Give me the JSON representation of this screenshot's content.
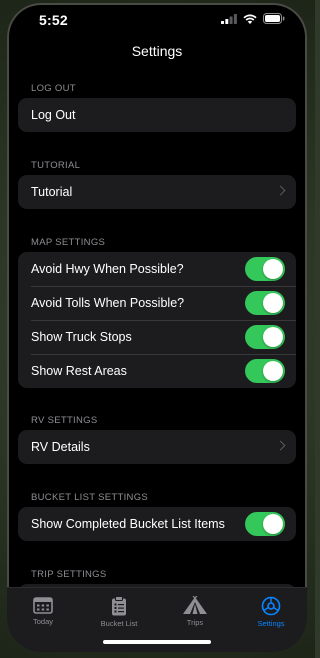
{
  "status_bar": {
    "time": "5:52"
  },
  "nav": {
    "title": "Settings"
  },
  "sections": {
    "log_out": {
      "header": "LOG OUT",
      "item": "Log Out"
    },
    "tutorial": {
      "header": "TUTORIAL",
      "item": "Tutorial"
    },
    "map_settings": {
      "header": "MAP SETTINGS",
      "items": [
        {
          "label": "Avoid Hwy When Possible?",
          "on": true
        },
        {
          "label": "Avoid Tolls When Possible?",
          "on": true
        },
        {
          "label": "Show Truck Stops",
          "on": true
        },
        {
          "label": "Show Rest Areas",
          "on": true
        }
      ]
    },
    "rv_settings": {
      "header": "RV SETTINGS",
      "item": "RV Details"
    },
    "bucket_list_settings": {
      "header": "BUCKET LIST SETTINGS",
      "item": {
        "label": "Show Completed Bucket List Items",
        "on": true
      }
    },
    "trip_settings": {
      "header": "TRIP SETTINGS"
    }
  },
  "tabbar": {
    "tabs": [
      {
        "label": "Today",
        "icon": "calendar-icon",
        "active": false
      },
      {
        "label": "Bucket List",
        "icon": "clipboard-icon",
        "active": false
      },
      {
        "label": "Trips",
        "icon": "tent-icon",
        "active": false
      },
      {
        "label": "Settings",
        "icon": "gear-icon",
        "active": true
      }
    ]
  },
  "colors": {
    "accent": "#0a84ff",
    "toggle_on": "#34c759",
    "background": "#000000",
    "cell": "#1c1c1e"
  }
}
